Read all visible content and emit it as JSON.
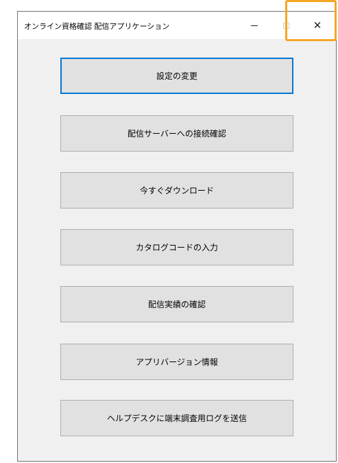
{
  "window": {
    "title": "オンライン資格確認 配信アプリケーション",
    "controls": {
      "minimize": "—",
      "close": "✕"
    }
  },
  "buttons": [
    {
      "label": "設定の変更"
    },
    {
      "label": "配信サーバーへの接続確認"
    },
    {
      "label": "今すぐダウンロード"
    },
    {
      "label": "カタログコードの入力"
    },
    {
      "label": "配信実績の確認"
    },
    {
      "label": "アプリバージョン情報"
    },
    {
      "label": "ヘルプデスクに端末調査用ログを送信"
    }
  ],
  "accent_colors": {
    "highlight": "#f5a623",
    "focus": "#0078d7"
  }
}
